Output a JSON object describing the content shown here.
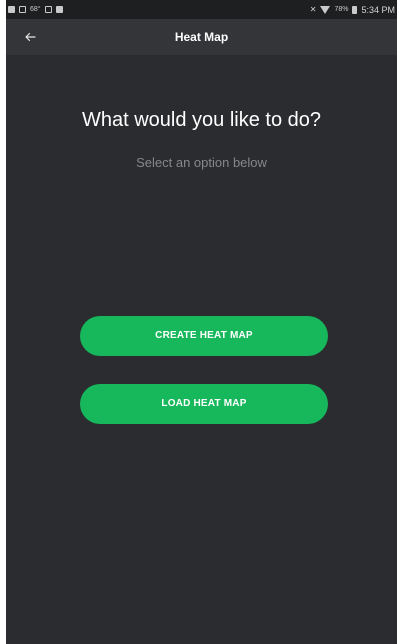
{
  "status_bar": {
    "temperature": "68°",
    "battery_percent": "78%",
    "time": "5:34 PM"
  },
  "app_bar": {
    "title": "Heat Map",
    "back_icon": "arrow-back-icon"
  },
  "main": {
    "heading": "What would you like to do?",
    "subheading": "Select an option below",
    "create_button_label": "CREATE HEAT MAP",
    "load_button_label": "LOAD HEAT MAP"
  },
  "colors": {
    "background": "#2b2c2f",
    "app_bar": "#343538",
    "accent_green": "#17b85c",
    "subtext": "#85878b"
  }
}
